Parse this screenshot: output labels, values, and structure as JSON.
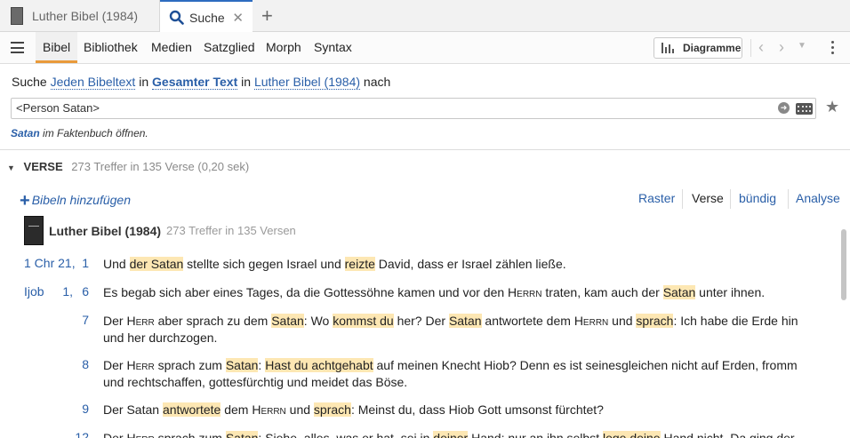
{
  "tabs": [
    {
      "label": "Luther Bibel (1984)"
    },
    {
      "label": "Suche"
    }
  ],
  "nav": {
    "items": [
      "Bibel",
      "Bibliothek",
      "Medien",
      "Satzglied",
      "Morph",
      "Syntax"
    ],
    "active": "Bibel",
    "diagram_label": "Diagramme"
  },
  "search": {
    "prefix": "Suche",
    "scope_type": "Jeden Bibeltext",
    "in1": "in",
    "scope_range": "Gesamter Text",
    "in2": "in",
    "bible": "Luther Bibel (1984)",
    "suffix": "nach",
    "query": "<Person Satan>",
    "fact_term": "Satan",
    "fact_rest": "im Faktenbuch öffnen."
  },
  "verses": {
    "header": "VERSE",
    "summary": "273 Treffer in 135 Verse (0,20 sek)",
    "add_bibles": "Bibeln hinzufügen",
    "views": [
      "Raster",
      "Verse",
      "bündig",
      "Analyse"
    ],
    "bible_name": "Luther Bibel (1984)",
    "bible_hits": "273 Treffer in 135 Versen"
  },
  "results": [
    {
      "book": "1 Chr 21,",
      "verse": "1"
    },
    {
      "book": "Ijob",
      "chapter": "1,",
      "verse": "6"
    },
    {
      "verse": "7"
    },
    {
      "verse": "8"
    },
    {
      "verse": "9"
    },
    {
      "verse": "12"
    }
  ],
  "colors": {
    "accent": "#2a5fa8",
    "highlight": "#fde7b3",
    "active_tab": "#e99a3a"
  }
}
